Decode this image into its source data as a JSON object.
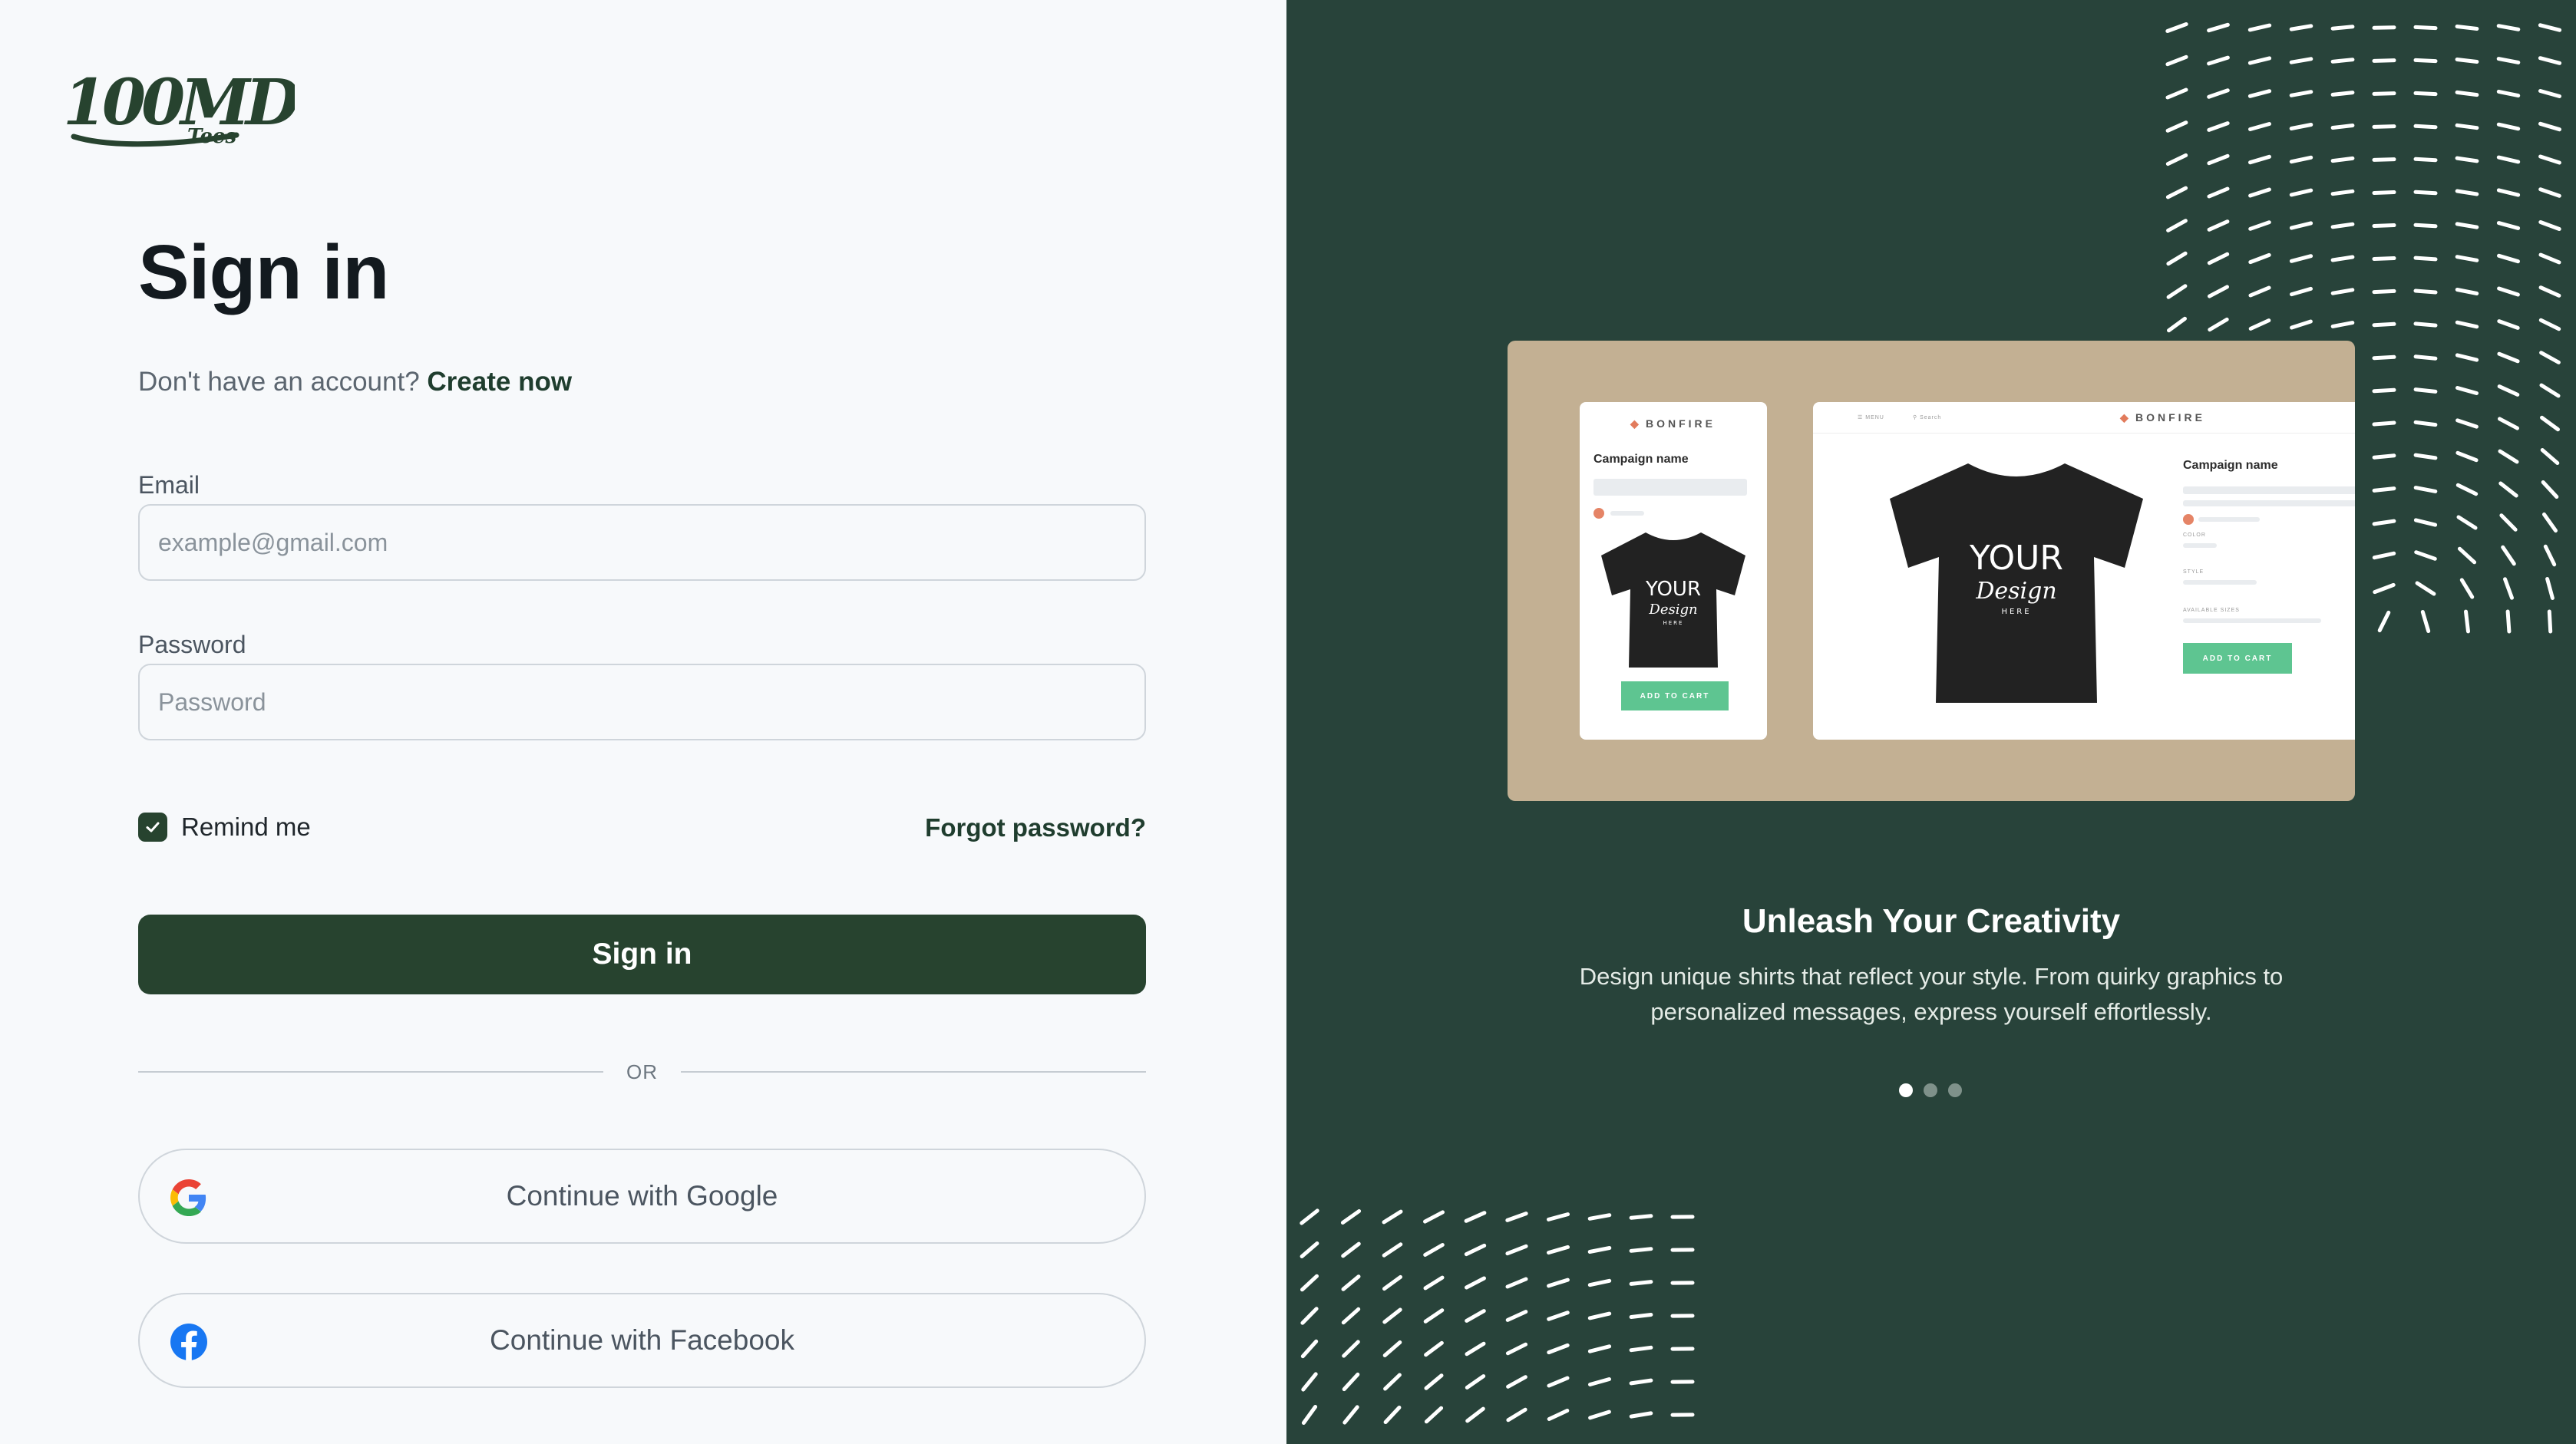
{
  "brand": {
    "logo_text": "100MD",
    "logo_subtext": "Tees"
  },
  "signin": {
    "title": "Sign in",
    "no_account_text": "Don't have an account?",
    "create_link": "Create now",
    "email_label": "Email",
    "email_placeholder": "example@gmail.com",
    "email_value": "",
    "password_label": "Password",
    "password_placeholder": "Password",
    "password_value": "",
    "remember_label": "Remind me",
    "remember_checked": true,
    "forgot_link": "Forgot password?",
    "submit_label": "Sign in",
    "divider_text": "OR",
    "google_label": "Continue with Google",
    "facebook_label": "Continue with Facebook"
  },
  "promo": {
    "mockup": {
      "brand_name": "BONFIRE",
      "campaign_name": "Campaign name",
      "shirt_text_line1": "YOUR",
      "shirt_text_line2": "Design",
      "shirt_text_line3": "HERE",
      "cart_button": "ADD TO CART",
      "menu_label": "MENU",
      "search_label": "Search",
      "color_label": "COLOR",
      "style_label": "STYLE",
      "sizes_label": "AVAILABLE SIZES"
    },
    "title": "Unleash Your Creativity",
    "description": "Design unique shirts that reflect your style. From quirky graphics to personalized messages, express yourself effortlessly.",
    "carousel": {
      "total": 3,
      "active_index": 0
    }
  },
  "colors": {
    "primary": "#27432f",
    "panel": "#28433a",
    "background": "#f7f9fb",
    "mockup_bg": "#c3b093",
    "cart_green": "#5ec591"
  },
  "icons": {
    "checkbox": "check-icon",
    "google": "google-icon",
    "facebook": "facebook-icon"
  }
}
